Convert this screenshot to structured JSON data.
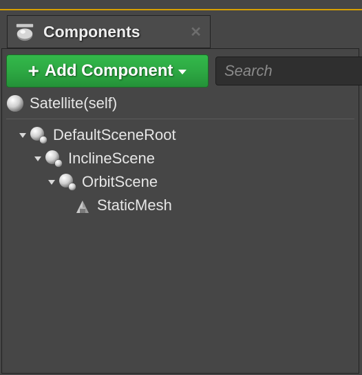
{
  "tab": {
    "title": "Components"
  },
  "toolbar": {
    "add_label": "Add Component",
    "search_placeholder": "Search"
  },
  "tree": {
    "actor": {
      "label": "Satellite(self)",
      "icon": "sphere-icon"
    },
    "n0": {
      "label": "DefaultSceneRoot",
      "icon": "scene-component-icon",
      "depth": 1,
      "expanded": true
    },
    "n1": {
      "label": "InclineScene",
      "icon": "scene-component-icon",
      "depth": 2,
      "expanded": true
    },
    "n2": {
      "label": "OrbitScene",
      "icon": "scene-component-icon",
      "depth": 3,
      "expanded": true
    },
    "n3": {
      "label": "StaticMesh",
      "icon": "static-mesh-icon",
      "depth": 4,
      "expanded": false
    }
  },
  "colors": {
    "accent": "#2da943",
    "highlight": "#d8a100",
    "bg": "#464646"
  }
}
